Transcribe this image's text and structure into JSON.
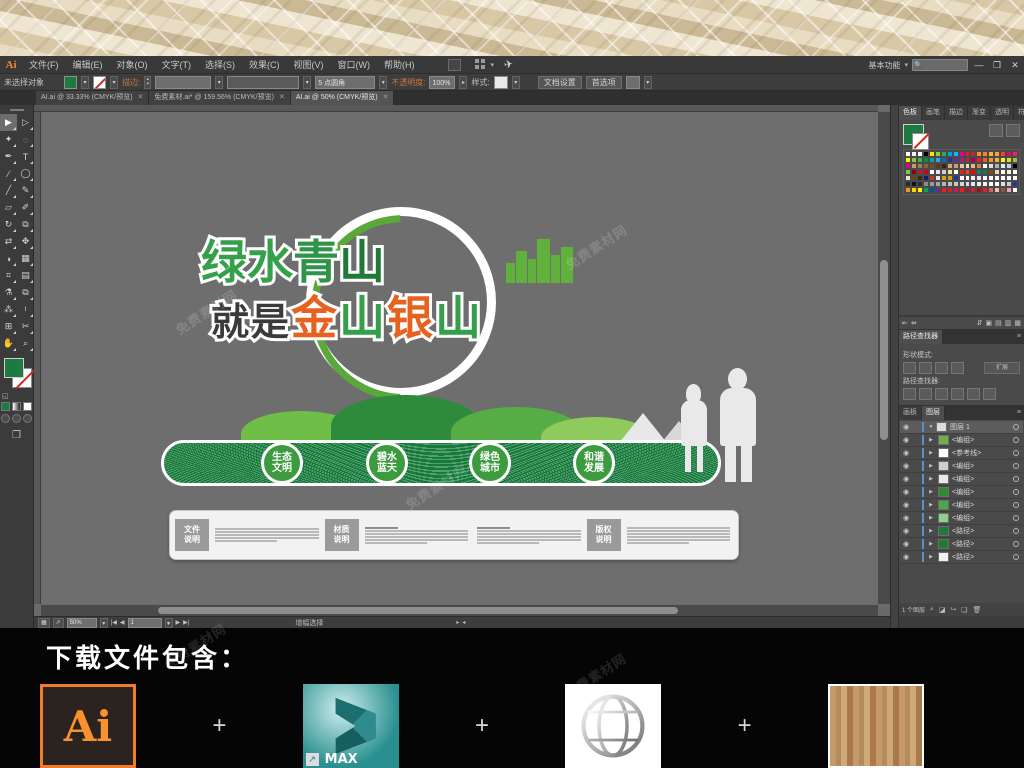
{
  "app": {
    "logo": "Ai",
    "menu": [
      {
        "label": "文件(F)"
      },
      {
        "label": "编辑(E)"
      },
      {
        "label": "对象(O)"
      },
      {
        "label": "文字(T)"
      },
      {
        "label": "选择(S)"
      },
      {
        "label": "效果(C)"
      },
      {
        "label": "视图(V)"
      },
      {
        "label": "窗口(W)"
      },
      {
        "label": "帮助(H)"
      }
    ],
    "workspace": "基本功能",
    "search_placeholder": "",
    "window_buttons": {
      "minimize": "—",
      "restore": "❐",
      "close": "✕"
    }
  },
  "control_bar": {
    "selection_status": "未选择对象",
    "fill_color": "#1d7a41",
    "stroke_label": "描边:",
    "stroke_weight": "5 点圆角",
    "opacity_label": "不透明度:",
    "opacity_value": "100%",
    "style_label": "样式:",
    "doc_setup": "文档设置",
    "preferences": "首选项"
  },
  "tabs": [
    {
      "label": "AI.ai @ 33.33% (CMYK/预览)",
      "active": false
    },
    {
      "label": "免费素材.ai* @ 159.56% (CMYK/预览)",
      "active": false
    },
    {
      "label": "AI.ai @ 50% (CMYK/预览)",
      "active": true
    }
  ],
  "toolbox": {
    "tools": [
      {
        "name": "selection-tool",
        "glyph": "▶",
        "selected": true
      },
      {
        "name": "direct-selection-tool",
        "glyph": "▷",
        "selected": false
      },
      {
        "name": "magic-wand-tool",
        "glyph": "✦",
        "selected": false
      },
      {
        "name": "lasso-tool",
        "glyph": "◌",
        "selected": false
      },
      {
        "name": "pen-tool",
        "glyph": "✒",
        "selected": false
      },
      {
        "name": "type-tool",
        "glyph": "T",
        "selected": false
      },
      {
        "name": "line-segment-tool",
        "glyph": "∕",
        "selected": false
      },
      {
        "name": "ellipse-tool",
        "glyph": "◯",
        "selected": false
      },
      {
        "name": "paintbrush-tool",
        "glyph": "╱",
        "selected": false
      },
      {
        "name": "pencil-tool",
        "glyph": "✎",
        "selected": false
      },
      {
        "name": "eraser-tool",
        "glyph": "▱",
        "selected": false
      },
      {
        "name": "blob-brush-tool",
        "glyph": "✐",
        "selected": false
      },
      {
        "name": "rotate-tool",
        "glyph": "↻",
        "selected": false
      },
      {
        "name": "scale-tool",
        "glyph": "⧉",
        "selected": false
      },
      {
        "name": "width-tool",
        "glyph": "⇄",
        "selected": false
      },
      {
        "name": "free-transform-tool",
        "glyph": "✥",
        "selected": false
      },
      {
        "name": "shape-builder-tool",
        "glyph": "◑",
        "selected": false
      },
      {
        "name": "perspective-grid-tool",
        "glyph": "▦",
        "selected": false
      },
      {
        "name": "mesh-tool",
        "glyph": "⌗",
        "selected": false
      },
      {
        "name": "gradient-tool",
        "glyph": "▤",
        "selected": false
      },
      {
        "name": "eyedropper-tool",
        "glyph": "⚗",
        "selected": false
      },
      {
        "name": "blend-tool",
        "glyph": "⧉",
        "selected": false
      },
      {
        "name": "symbol-sprayer-tool",
        "glyph": "⁂",
        "selected": false
      },
      {
        "name": "column-graph-tool",
        "glyph": "ᴵ",
        "selected": false
      },
      {
        "name": "artboard-tool",
        "glyph": "⊞",
        "selected": false
      },
      {
        "name": "slice-tool",
        "glyph": "✂",
        "selected": false
      },
      {
        "name": "hand-tool",
        "glyph": "✋",
        "selected": false
      },
      {
        "name": "zoom-tool",
        "glyph": "⌕",
        "selected": false
      }
    ],
    "fill_color": "#1d7a41",
    "stroke_color": "#ffffff"
  },
  "artwork": {
    "title_line1": [
      {
        "char": "绿",
        "color": "#35a04a"
      },
      {
        "char": "水",
        "color": "#35a04a"
      },
      {
        "char": "青",
        "color": "#2f9447"
      },
      {
        "char": "山",
        "color": "#1f7a35"
      }
    ],
    "title_line2_prefix": [
      {
        "char": "就",
        "color": "#3a3a3a"
      },
      {
        "char": "是",
        "color": "#3a3a3a"
      }
    ],
    "title_line2_main": [
      {
        "char": "金",
        "color": "#e8621f"
      },
      {
        "char": "山",
        "color": "#35a04a"
      },
      {
        "char": "银",
        "color": "#e8621f"
      },
      {
        "char": "山",
        "color": "#35a04a"
      }
    ],
    "badges": [
      {
        "line1": "生态",
        "line2": "文明"
      },
      {
        "line1": "碧水",
        "line2": "蓝天"
      },
      {
        "line1": "绿色",
        "line2": "城市"
      },
      {
        "line1": "和谐",
        "line2": "发展"
      }
    ],
    "info_sections": [
      {
        "label_line1": "文件",
        "label_line2": "说明"
      },
      {
        "label_line1": "材质",
        "label_line2": "说明"
      },
      {
        "label_line1": "版权",
        "label_line2": "说明"
      }
    ],
    "colors": {
      "band_green": "#157a3a",
      "badge_green": "#3c9a3f",
      "orange": "#e8621f",
      "light_green": "#5fb13c"
    }
  },
  "panels": {
    "swatches": {
      "tabs": [
        {
          "label": "色板",
          "active": true
        },
        {
          "label": "画笔",
          "active": false
        },
        {
          "label": "描边",
          "active": false
        },
        {
          "label": "渐变",
          "active": false
        },
        {
          "label": "透明",
          "active": false
        },
        {
          "label": "符号",
          "active": false
        }
      ],
      "colors": [
        "#ffffff",
        "#f2f2f2",
        "#ffffff",
        "#000000",
        "#ffe400",
        "#9acd32",
        "#22b14c",
        "#00a2e8",
        "#00bff3",
        "#ec008c",
        "#ed1c24",
        "#c1272d",
        "#f7941d",
        "#ff7f27",
        "#fbb03b",
        "#f5a623",
        "#ef4136",
        "#d4145a",
        "#ed1e79",
        "#fff200",
        "#8cc63f",
        "#39b54a",
        "#009245",
        "#00a99d",
        "#29abe2",
        "#0071bc",
        "#2e3192",
        "#662d91",
        "#92278f",
        "#c1272d",
        "#9e005d",
        "#ed1c24",
        "#f15a24",
        "#f7931e",
        "#fbb03b",
        "#fcee21",
        "#d9e021",
        "#8cc63f",
        "#e6007e",
        "#c69c6d",
        "#a67c52",
        "#8c6239",
        "#754c24",
        "#603813",
        "#42210b",
        "#d9a679",
        "#c89f70",
        "#e0c9a6",
        "#f5deb3",
        "#deb887",
        "#cd853f",
        "#ffffff",
        "#dcdcdc",
        "#b0b0b0",
        "#e8e8e8",
        "#bfd5e8",
        "#000000",
        "#7ac943",
        "#8b0000",
        "#b22222",
        "#d2001f",
        "#ffffff",
        "#e8e8e8",
        "#cfcfcf",
        "#f0e68c",
        "#ffffff",
        "#ed1c24",
        "#ff3b30",
        "#ff0000",
        "#1a7a6e",
        "#117a5c",
        "#8b4513",
        "#e6d8b8",
        "#ffffff",
        "#f5f5dc",
        "#ffffff",
        "#efe4c8",
        "#6b4423",
        "#3a2a18",
        "#1a1a6e",
        "#c0392b",
        "#e8e8e8",
        "#d4a017",
        "#c8a415",
        "#1a3a8f",
        "#ffffff",
        "#ffffff",
        "#f2f2f2",
        "#e8e8e8",
        "#ffffff",
        "#ffffff",
        "#ffffff",
        "#ffffff",
        "#ffffff",
        "#ffffff",
        "#2b2b2b",
        "#111111",
        "#2b2b2b",
        "#8a8a8a",
        "#9a9a9a",
        "#a8a8a8",
        "#b5b5b5",
        "#c0c0c0",
        "#cacaca",
        "#d4d4d4",
        "#dedede",
        "#e6e6e6",
        "#eeeeee",
        "#f4f4f4",
        "#fafafa",
        "#ffffff",
        "#e0e0e0",
        "#cccccc",
        "#1a3a8f",
        "#f7931e",
        "#ffd400",
        "#fff200",
        "#00a651",
        "#0054a6",
        "#662d91",
        "#ed1c24",
        "#c1272d",
        "#d4145a",
        "#ed1c24",
        "#b11226",
        "#c1272d",
        "#a01020",
        "#ed1c24",
        "#d8605a",
        "#f0c0b8",
        "#8b5a2b",
        "#f49ac1",
        "#ffffff"
      ]
    },
    "pathfinder": {
      "tab": "路径查找器",
      "shape_modes_label": "形状模式:",
      "expand_button": "扩展",
      "pathfinders_label": "路径查找器:"
    },
    "layers": {
      "tabs": [
        {
          "label": "画板",
          "active": false
        },
        {
          "label": "图层",
          "active": true
        }
      ],
      "rows": [
        {
          "name": "图层 1",
          "depth": 0,
          "thumb": "#dcdcdc",
          "expanded": true,
          "selected": true
        },
        {
          "name": "<编组>",
          "depth": 1,
          "thumb": "#6fae4a",
          "expanded": false,
          "selected": false
        },
        {
          "name": "<参考线>",
          "depth": 1,
          "thumb": "#ffffff",
          "expanded": false,
          "selected": false
        },
        {
          "name": "<编组>",
          "depth": 1,
          "thumb": "#cfcfcf",
          "expanded": false,
          "selected": false
        },
        {
          "name": "<编组>",
          "depth": 1,
          "thumb": "#e8e8e8",
          "expanded": false,
          "selected": false
        },
        {
          "name": "<编组>",
          "depth": 1,
          "thumb": "#2e8b2e",
          "expanded": false,
          "selected": false
        },
        {
          "name": "<编组>",
          "depth": 1,
          "thumb": "#4aa84a",
          "expanded": false,
          "selected": false
        },
        {
          "name": "<编组>",
          "depth": 1,
          "thumb": "#8fd08f",
          "expanded": false,
          "selected": false
        },
        {
          "name": "<路径>",
          "depth": 1,
          "thumb": "#1f7a35",
          "expanded": false,
          "selected": false
        },
        {
          "name": "<路径>",
          "depth": 1,
          "thumb": "#1f7a35",
          "expanded": false,
          "selected": false
        },
        {
          "name": "<路径>",
          "depth": 1,
          "thumb": "#f0f0f0",
          "expanded": false,
          "selected": false
        }
      ],
      "footer_count": "1 个图层"
    }
  },
  "status_bar": {
    "zoom": "50%",
    "page": "1",
    "tool_text": "增幅选择"
  },
  "download_section": {
    "title": "下载文件包含：",
    "plus": "+",
    "items": [
      {
        "name": "illustrator-file-icon",
        "label": "Ai"
      },
      {
        "name": "3dsmax-file-icon",
        "label": "MAX"
      },
      {
        "name": "globe-file-icon",
        "label": ""
      },
      {
        "name": "wood-texture-icon",
        "label": ""
      }
    ]
  },
  "watermark": "免费素材网"
}
